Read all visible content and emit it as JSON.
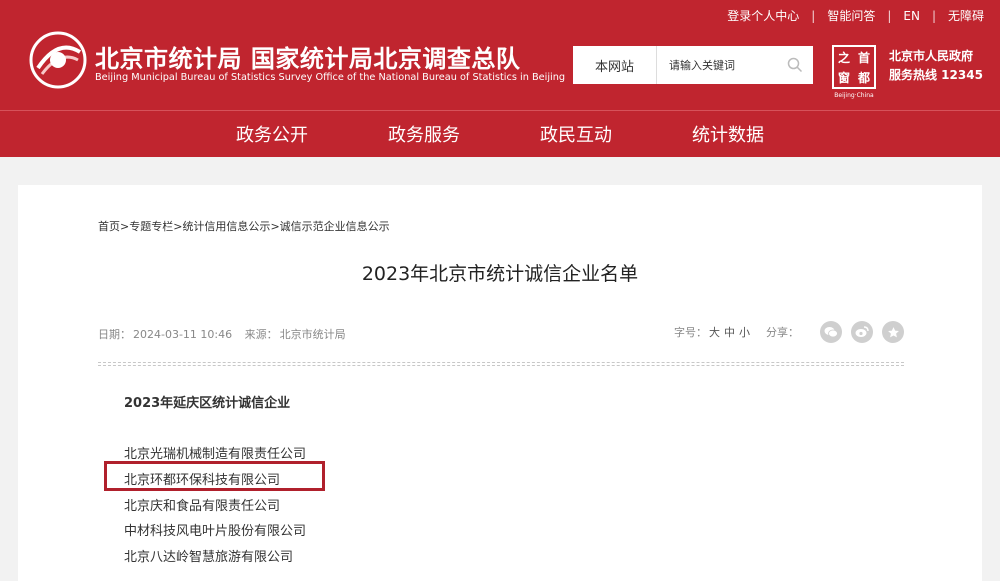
{
  "top_links": [
    "登录个人中心",
    "智能问答",
    "EN",
    "无障碍"
  ],
  "header": {
    "title_cn": "北京市统计局 国家统计局北京调查总队",
    "title_en": "Beijing Municipal Bureau of Statistics  Survey Office of the National Bureau of Statistics in Beijing"
  },
  "search": {
    "scope": "本网站",
    "placeholder": "请输入关键词"
  },
  "capital_logo": {
    "chars": [
      "之",
      "首",
      "窗",
      "都"
    ],
    "sub": "Beijing·China"
  },
  "gov": {
    "name": "北京市人民政府",
    "hotline": "服务热线 12345"
  },
  "nav": [
    "政务公开",
    "政务服务",
    "政民互动",
    "统计数据"
  ],
  "breadcrumb": [
    "首页",
    "专题专栏",
    "统计信用信息公示",
    "诚信示范企业信息公示"
  ],
  "breadcrumb_sep": ">",
  "article": {
    "title": "2023年北京市统计诚信企业名单",
    "date_label": "日期：",
    "date": "2024-03-11 10:46",
    "source_label": "来源：",
    "source": "北京市统计局",
    "font_size_label": "字号：",
    "font_sizes": [
      "大",
      "中",
      "小"
    ],
    "share_label": "分享："
  },
  "section_heading": "2023年延庆区统计诚信企业",
  "companies": [
    "北京光瑞机械制造有限责任公司",
    "北京环都环保科技有限公司",
    "北京庆和食品有限责任公司",
    "中材科技风电叶片股份有限公司",
    "北京八达岭智慧旅游有限公司"
  ],
  "colors": {
    "brand_red": "#c0252f",
    "highlight": "#b0202c"
  }
}
